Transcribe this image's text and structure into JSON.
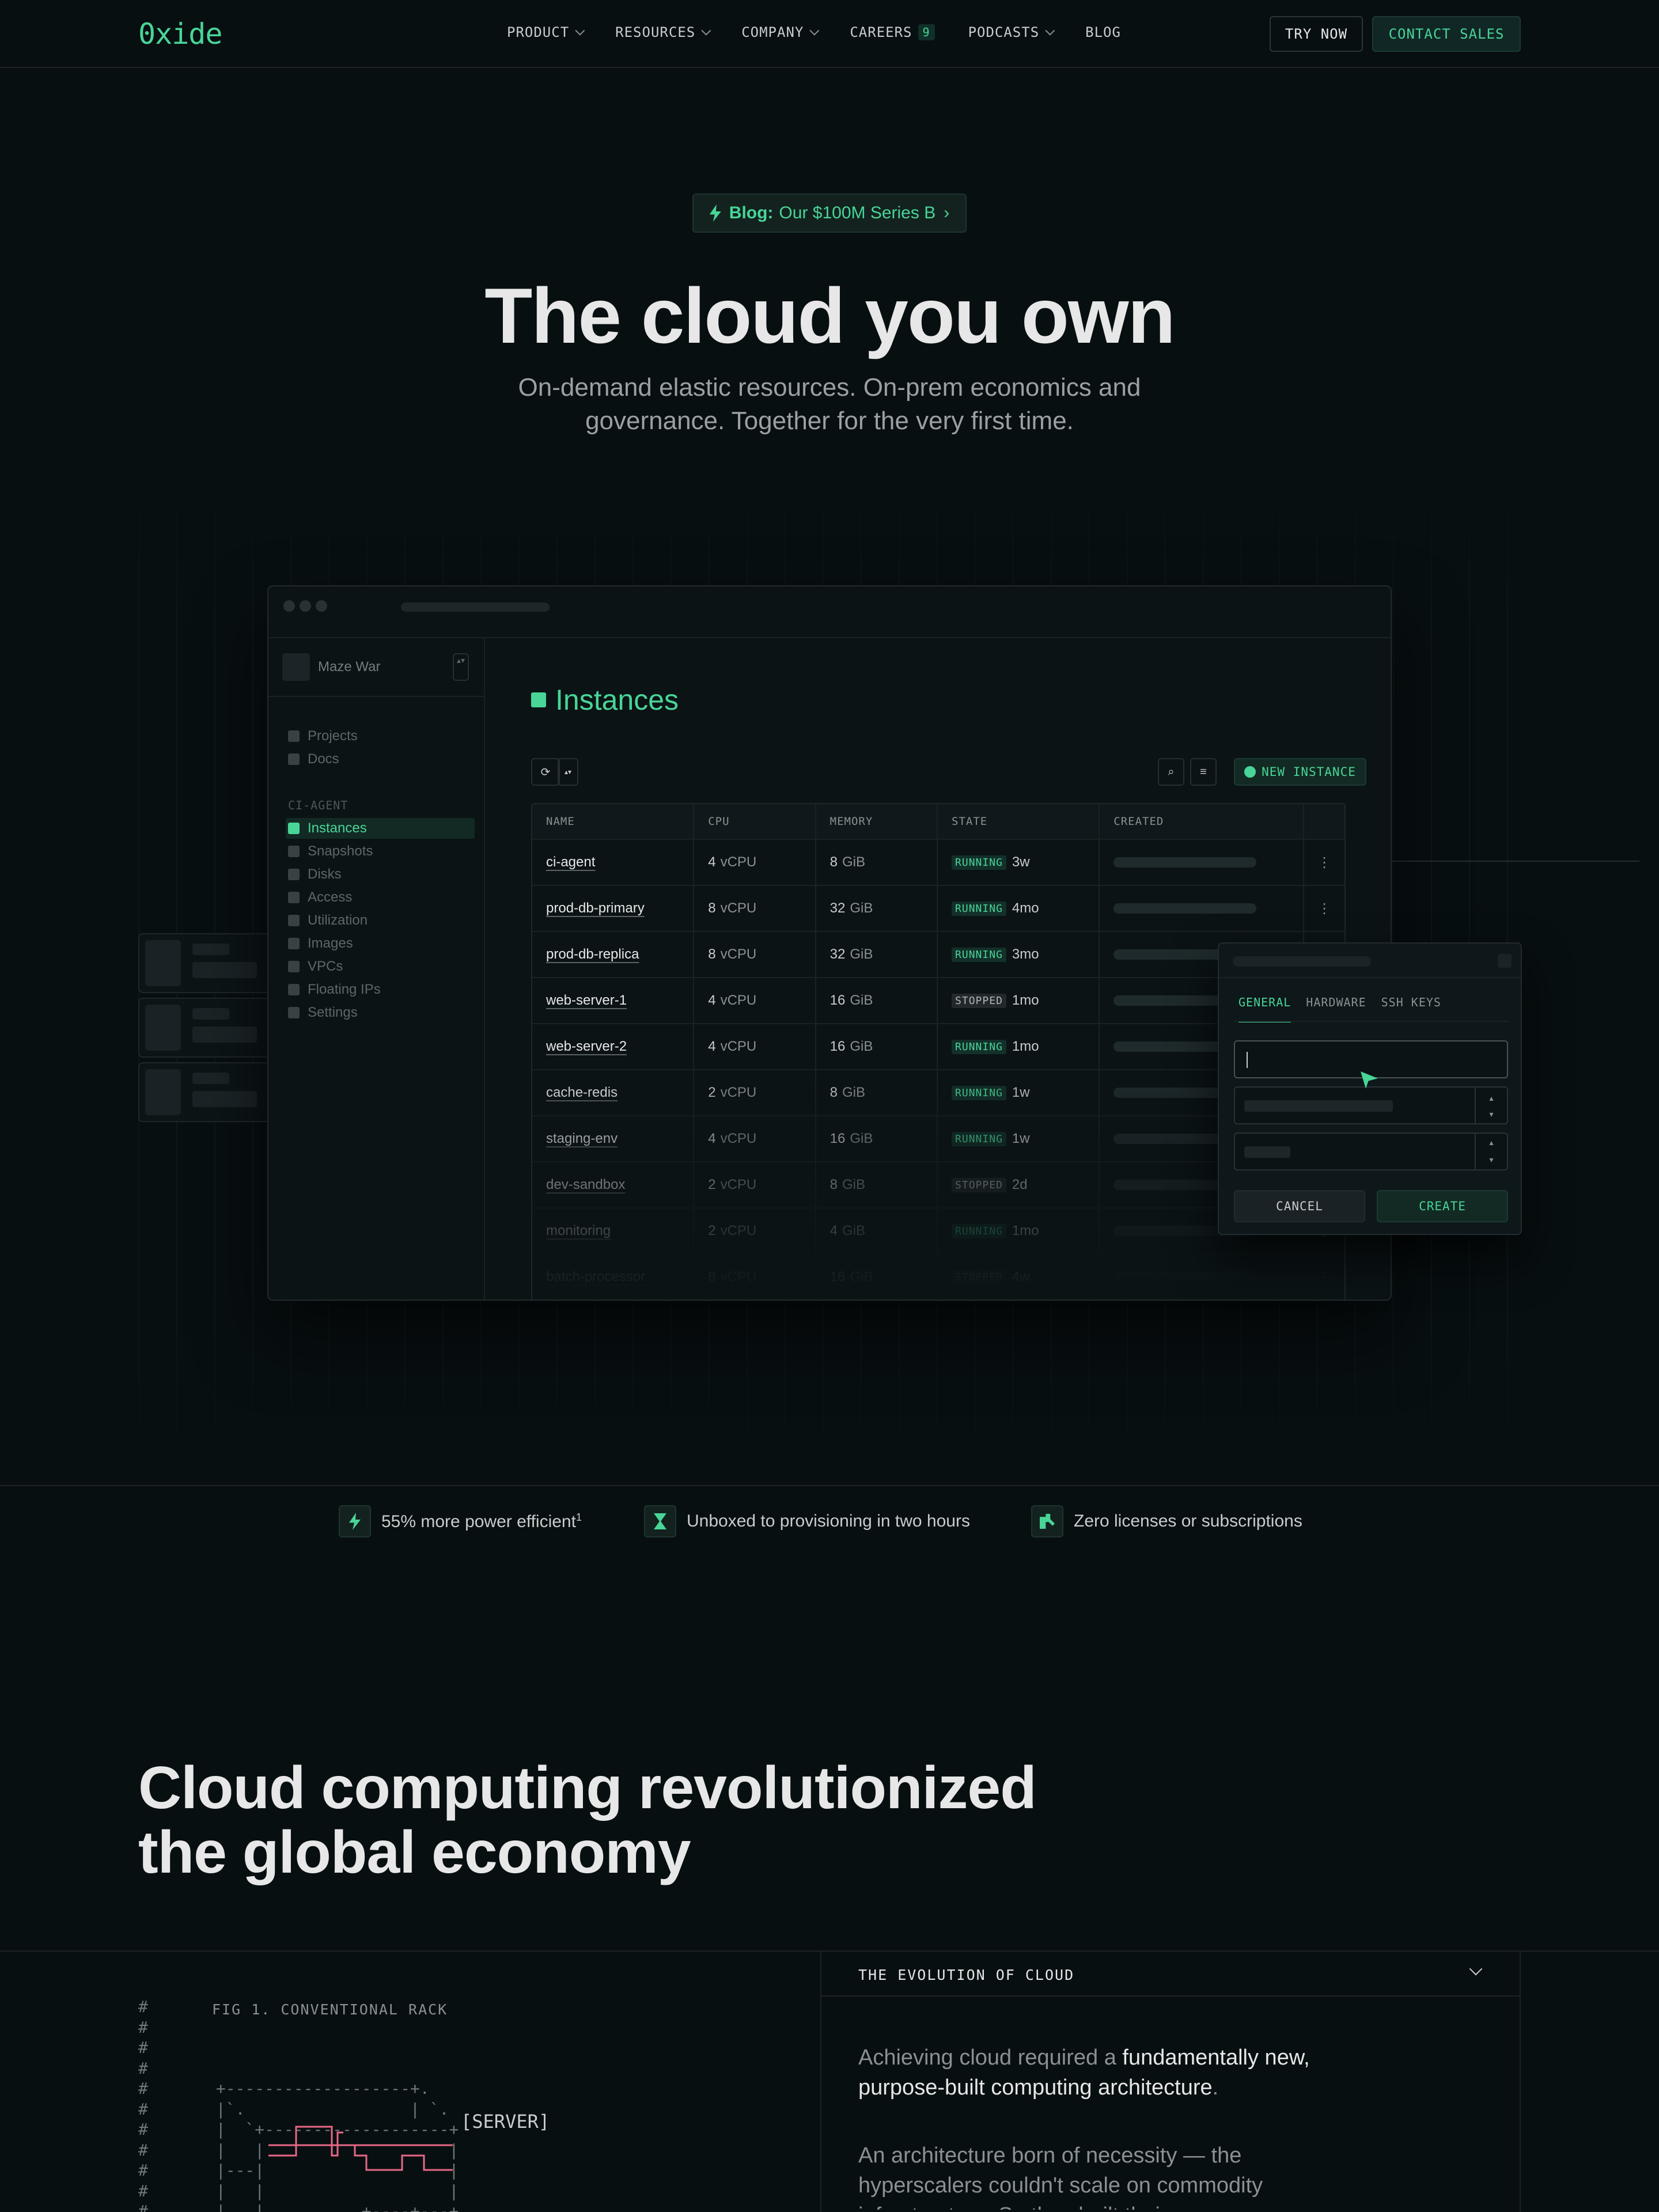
{
  "nav": {
    "logo": "0xide",
    "links": [
      {
        "label": "PRODUCT"
      },
      {
        "label": "RESOURCES"
      },
      {
        "label": "COMPANY"
      },
      {
        "label": "CAREERS",
        "badge": "9"
      },
      {
        "label": "PODCASTS"
      },
      {
        "label": "BLOG"
      }
    ],
    "try_now": "TRY NOW",
    "contact_sales": "CONTACT SALES"
  },
  "hero": {
    "pill_prefix": "Blog:",
    "pill_text": "Our $100M Series B",
    "pill_arrow": "›",
    "title": "The cloud you own",
    "subtitle": "On-demand elastic resources. On-prem economics and governance. Together for the very first time."
  },
  "console": {
    "project_name": "Maze War",
    "project_selector": "▴▾",
    "sidebar_top": [
      {
        "label": "Projects",
        "icon": "folder-icon"
      },
      {
        "label": "Docs",
        "icon": "document-icon"
      }
    ],
    "sidebar_section": "CI-AGENT",
    "sidebar_items": [
      {
        "label": "Instances",
        "icon": "instances-icon"
      },
      {
        "label": "Snapshots",
        "icon": "snapshot-icon"
      },
      {
        "label": "Disks",
        "icon": "disk-icon"
      },
      {
        "label": "Access",
        "icon": "access-icon"
      },
      {
        "label": "Utilization",
        "icon": "utilization-icon"
      },
      {
        "label": "Images",
        "icon": "images-icon"
      },
      {
        "label": "VPCs",
        "icon": "vpc-icon"
      },
      {
        "label": "Floating IPs",
        "icon": "globe-icon"
      },
      {
        "label": "Settings",
        "icon": "gear-icon"
      }
    ],
    "page_title": "Instances",
    "new_instance": "NEW INSTANCE",
    "columns": [
      "NAME",
      "CPU",
      "MEMORY",
      "STATE",
      "CREATED"
    ],
    "rows": [
      {
        "name": "ci-agent",
        "cpu": "4",
        "cpu_unit": "vCPU",
        "mem": "8",
        "mem_unit": "GiB",
        "state": "RUNNING",
        "age": "3w"
      },
      {
        "name": "prod-db-primary",
        "cpu": "8",
        "cpu_unit": "vCPU",
        "mem": "32",
        "mem_unit": "GiB",
        "state": "RUNNING",
        "age": "4mo"
      },
      {
        "name": "prod-db-replica",
        "cpu": "8",
        "cpu_unit": "vCPU",
        "mem": "32",
        "mem_unit": "GiB",
        "state": "RUNNING",
        "age": "3mo"
      },
      {
        "name": "web-server-1",
        "cpu": "4",
        "cpu_unit": "vCPU",
        "mem": "16",
        "mem_unit": "GiB",
        "state": "STOPPED",
        "age": "1mo"
      },
      {
        "name": "web-server-2",
        "cpu": "4",
        "cpu_unit": "vCPU",
        "mem": "16",
        "mem_unit": "GiB",
        "state": "RUNNING",
        "age": "1mo"
      },
      {
        "name": "cache-redis",
        "cpu": "2",
        "cpu_unit": "vCPU",
        "mem": "8",
        "mem_unit": "GiB",
        "state": "RUNNING",
        "age": "1w"
      },
      {
        "name": "staging-env",
        "cpu": "4",
        "cpu_unit": "vCPU",
        "mem": "16",
        "mem_unit": "GiB",
        "state": "RUNNING",
        "age": "1w"
      },
      {
        "name": "dev-sandbox",
        "cpu": "2",
        "cpu_unit": "vCPU",
        "mem": "8",
        "mem_unit": "GiB",
        "state": "STOPPED",
        "age": "2d"
      },
      {
        "name": "monitoring",
        "cpu": "2",
        "cpu_unit": "vCPU",
        "mem": "4",
        "mem_unit": "GiB",
        "state": "RUNNING",
        "age": "1mo"
      },
      {
        "name": "batch-processor",
        "cpu": "8",
        "cpu_unit": "vCPU",
        "mem": "16",
        "mem_unit": "GiB",
        "state": "STOPPED",
        "age": "4w"
      }
    ],
    "dialog": {
      "tabs": [
        "GENERAL",
        "HARDWARE",
        "SSH KEYS"
      ],
      "cancel": "CANCEL",
      "create": "CREATE"
    }
  },
  "features": [
    {
      "text": "55% more power efficient",
      "sup": "1",
      "icon": "bolt-icon"
    },
    {
      "text": "Unboxed to provisioning in two hours",
      "icon": "hourglass-icon"
    },
    {
      "text": "Zero licenses or subscriptions",
      "icon": "key-icon"
    }
  ],
  "section": {
    "title_line1": "Cloud computing revolutionized",
    "title_line2": "the global economy",
    "fig_label": "FIG 1. CONVENTIONAL RACK",
    "server_label": "[SERVER]",
    "evolution_title": "THE EVOLUTION OF CLOUD",
    "p1_a": "Achieving cloud required a ",
    "p1_b": "fundamentally new, purpose-built computing architecture",
    "p1_c": ".",
    "p2_a": "An architecture born of necessity — the hyperscalers couldn't scale on commodity infrastructure. So they built their own."
  },
  "colors": {
    "accent": "#48d597",
    "background": "#080f11",
    "alert": "#e86886"
  }
}
